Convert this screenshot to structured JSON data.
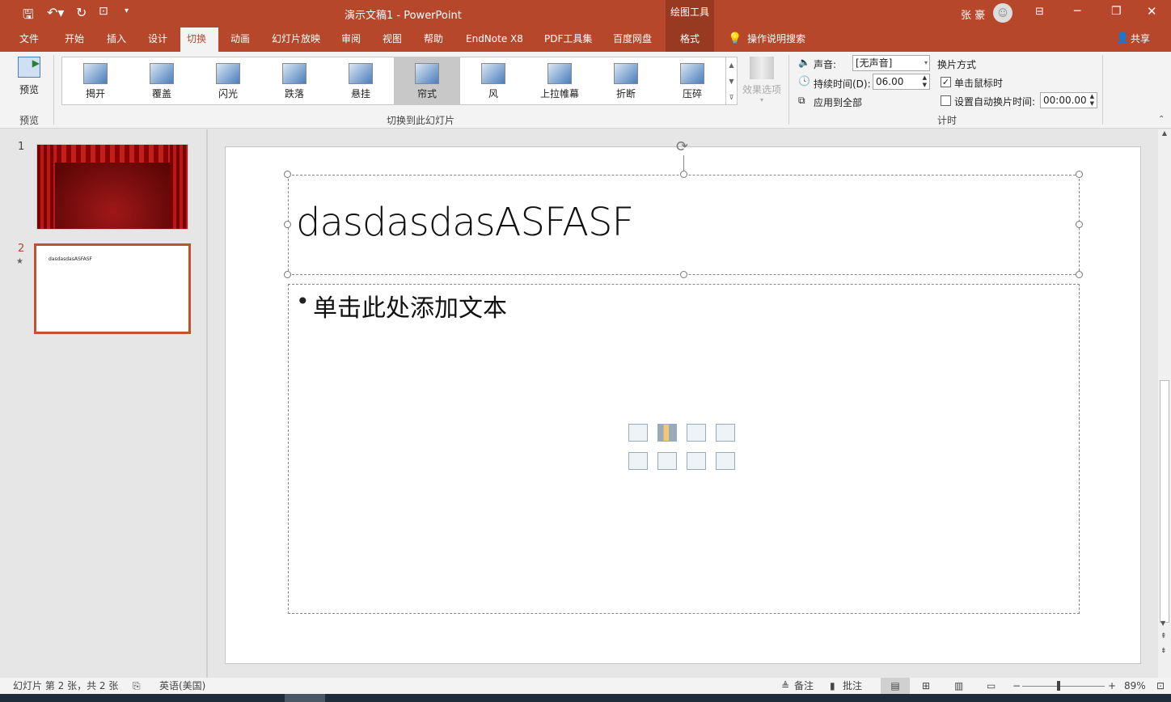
{
  "title": {
    "doc": "演示文稿1  -  PowerPoint",
    "context_tools": "绘图工具",
    "user": "张 豪"
  },
  "tabs": [
    "文件",
    "开始",
    "插入",
    "设计",
    "切换",
    "动画",
    "幻灯片放映",
    "审阅",
    "视图",
    "帮助",
    "EndNote X8",
    "PDF工具集",
    "百度网盘",
    "格式"
  ],
  "active_tab": "切换",
  "tell_me": "操作说明搜索",
  "share": "共享",
  "ribbon": {
    "preview_label": "预览",
    "preview_group": "预览",
    "transitions": [
      "揭开",
      "覆盖",
      "闪光",
      "跌落",
      "悬挂",
      "帘式",
      "风",
      "上拉帷幕",
      "折断",
      "压碎"
    ],
    "selected_transition": "帘式",
    "effect_options": "效果选项",
    "transition_group": "切换到此幻灯片",
    "sound_label": "声音:",
    "sound_value": "[无声音]",
    "duration_label": "持续时间(D):",
    "duration_value": "06.00",
    "apply_all": "应用到全部",
    "advance_title": "换片方式",
    "on_click": "单击鼠标时",
    "on_click_checked": true,
    "after_label": "设置自动换片时间:",
    "after_checked": false,
    "after_value": "00:00.00",
    "timing_group": "计时"
  },
  "thumbnails": [
    {
      "num": "1"
    },
    {
      "num": "2",
      "text": "dasdasdasASFASF",
      "star": "★"
    }
  ],
  "slide": {
    "title": "dasdasdasASFASF",
    "body": "单击此处添加文本",
    "bullet": "•"
  },
  "status": {
    "slide_info": "幻灯片 第 2 张，共 2 张",
    "language": "英语(美国)",
    "notes": "备注",
    "comments": "批注",
    "zoom": "89%",
    "zoom_minus": "−",
    "zoom_plus": "+"
  },
  "colors": {
    "accent": "#b7472a"
  }
}
